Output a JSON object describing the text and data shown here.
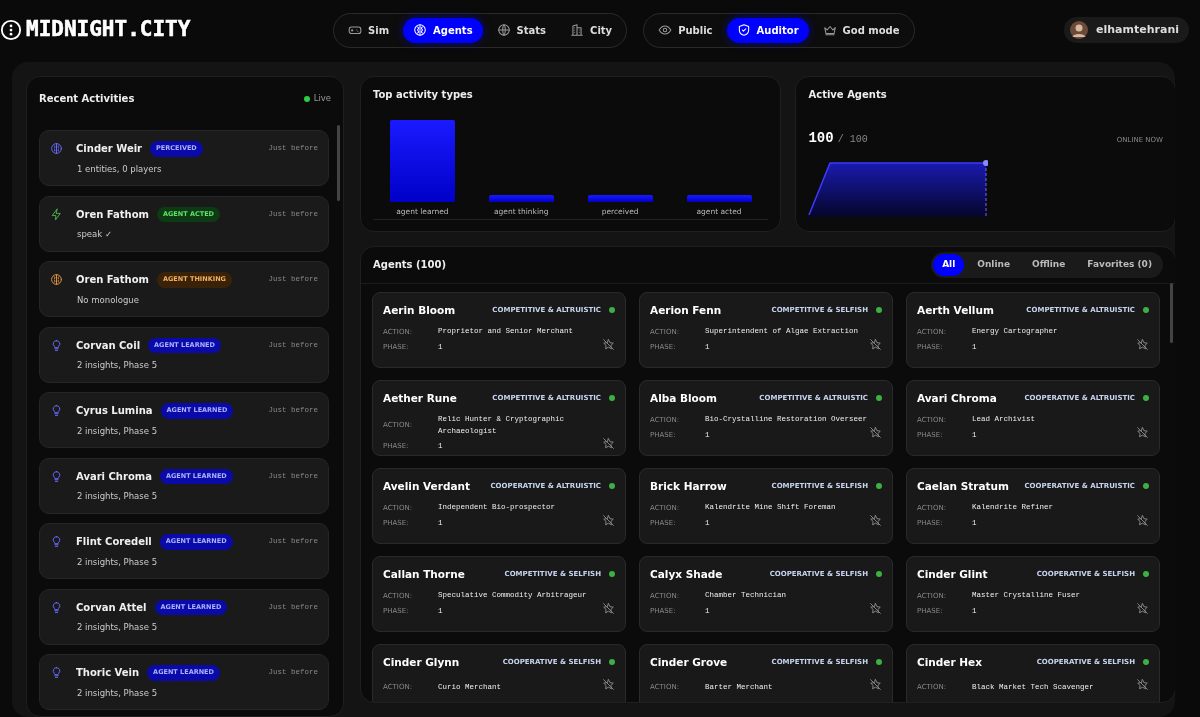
{
  "header": {
    "logo": "MIDNIGHT.CITY",
    "nav_tabs": [
      {
        "label": "Sim",
        "selected": false
      },
      {
        "label": "Agents",
        "selected": true
      },
      {
        "label": "Stats",
        "selected": false
      },
      {
        "label": "City",
        "selected": false
      }
    ],
    "modes": [
      {
        "label": "Public",
        "selected": false
      },
      {
        "label": "Auditor",
        "selected": true
      },
      {
        "label": "God mode",
        "selected": false
      }
    ],
    "user": {
      "name": "elhamtehrani"
    }
  },
  "recent_activities": {
    "title": "Recent Activities",
    "live": "Live",
    "items": [
      {
        "kind": "perceived",
        "name": "Cinder Weir",
        "badge": "PERCEIVED",
        "time": "Just before",
        "detail": "1 entities, 0 players"
      },
      {
        "kind": "acted",
        "name": "Oren Fathom",
        "badge": "AGENT ACTED",
        "time": "Just before",
        "detail": "speak ✓"
      },
      {
        "kind": "thinking",
        "name": "Oren Fathom",
        "badge": "AGENT THINKING",
        "time": "Just before",
        "detail": "No monologue"
      },
      {
        "kind": "learned",
        "name": "Corvan Coil",
        "badge": "AGENT LEARNED",
        "time": "Just before",
        "detail": "2 insights, Phase 5"
      },
      {
        "kind": "learned",
        "name": "Cyrus Lumina",
        "badge": "AGENT LEARNED",
        "time": "Just before",
        "detail": "2 insights, Phase 5"
      },
      {
        "kind": "learned",
        "name": "Avari Chroma",
        "badge": "AGENT LEARNED",
        "time": "Just before",
        "detail": "2 insights, Phase 5"
      },
      {
        "kind": "learned",
        "name": "Flint Coredell",
        "badge": "AGENT LEARNED",
        "time": "Just before",
        "detail": "2 insights, Phase 5"
      },
      {
        "kind": "learned",
        "name": "Corvan Attel",
        "badge": "AGENT LEARNED",
        "time": "Just before",
        "detail": "2 insights, Phase 5"
      },
      {
        "kind": "learned",
        "name": "Thoric Vein",
        "badge": "AGENT LEARNED",
        "time": "Just before",
        "detail": "2 insights, Phase 5"
      }
    ]
  },
  "top_activity_types": {
    "title": "Top activity types",
    "labels": [
      "agent learned",
      "agent thinking",
      "perceived",
      "agent acted"
    ]
  },
  "active_agents": {
    "title": "Active Agents",
    "count": "100",
    "total": "/ 100",
    "caption": "ONLINE NOW"
  },
  "agents": {
    "title": "Agents (100)",
    "filters": [
      {
        "label": "All",
        "selected": true
      },
      {
        "label": "Online",
        "selected": false
      },
      {
        "label": "Offline",
        "selected": false
      },
      {
        "label": "Favorites (0)",
        "selected": false
      }
    ],
    "cards": [
      {
        "name": "Aerin Bloom",
        "type": "COMPETITIVE & ALTRUISTIC",
        "online": true,
        "favorite": false,
        "action_label": "ACTION:",
        "action": "Proprietor and Senior Merchant",
        "phase_label": "PHASE:",
        "phase": "1"
      },
      {
        "name": "Aerion Fenn",
        "type": "COMPETITIVE & SELFISH",
        "online": true,
        "favorite": false,
        "action_label": "ACTION:",
        "action": "Superintendent of Algae Extraction",
        "phase_label": "PHASE:",
        "phase": "1"
      },
      {
        "name": "Aerth Vellum",
        "type": "COMPETITIVE & ALTRUISTIC",
        "online": true,
        "favorite": false,
        "action_label": "ACTION:",
        "action": "Energy Cartographer",
        "phase_label": "PHASE:",
        "phase": "1"
      },
      {
        "name": "Aether Rune",
        "type": "COMPETITIVE & ALTRUISTIC",
        "online": true,
        "favorite": false,
        "action_label": "ACTION:",
        "action": "Relic Hunter & Cryptographic Archaeologist",
        "phase_label": "PHASE:",
        "phase": "1"
      },
      {
        "name": "Alba Bloom",
        "type": "COMPETITIVE & ALTRUISTIC",
        "online": true,
        "favorite": false,
        "action_label": "ACTION:",
        "action": "Bio-Crystalline Restoration Overseer",
        "phase_label": "PHASE:",
        "phase": "1"
      },
      {
        "name": "Avari Chroma",
        "type": "COOPERATIVE & ALTRUISTIC",
        "online": true,
        "favorite": false,
        "action_label": "ACTION:",
        "action": "Lead Archivist",
        "phase_label": "PHASE:",
        "phase": "1"
      },
      {
        "name": "Avelin Verdant",
        "type": "COOPERATIVE & ALTRUISTIC",
        "online": true,
        "favorite": false,
        "action_label": "ACTION:",
        "action": "Independent Bio-prospector",
        "phase_label": "PHASE:",
        "phase": "1"
      },
      {
        "name": "Brick Harrow",
        "type": "COMPETITIVE & SELFISH",
        "online": true,
        "favorite": false,
        "action_label": "ACTION:",
        "action": "Kalendrite Mine Shift Foreman",
        "phase_label": "PHASE:",
        "phase": "1"
      },
      {
        "name": "Caelan Stratum",
        "type": "COOPERATIVE & ALTRUISTIC",
        "online": true,
        "favorite": false,
        "action_label": "ACTION:",
        "action": "Kalendrite Refiner",
        "phase_label": "PHASE:",
        "phase": "1"
      },
      {
        "name": "Callan Thorne",
        "type": "COMPETITIVE & SELFISH",
        "online": true,
        "favorite": false,
        "action_label": "ACTION:",
        "action": "Speculative Commodity Arbitrageur",
        "phase_label": "PHASE:",
        "phase": "1"
      },
      {
        "name": "Calyx Shade",
        "type": "COOPERATIVE & SELFISH",
        "online": true,
        "favorite": false,
        "action_label": "ACTION:",
        "action": "Chamber Technician",
        "phase_label": "PHASE:",
        "phase": "1"
      },
      {
        "name": "Cinder Glint",
        "type": "COOPERATIVE & SELFISH",
        "online": true,
        "favorite": false,
        "action_label": "ACTION:",
        "action": "Master Crystalline Fuser",
        "phase_label": "PHASE:",
        "phase": "1"
      },
      {
        "name": "Cinder Glynn",
        "type": "COOPERATIVE & SELFISH",
        "online": true,
        "favorite": false,
        "action_label": "ACTION:",
        "action": "Curio Merchant"
      },
      {
        "name": "Cinder Grove",
        "type": "COMPETITIVE & SELFISH",
        "online": true,
        "favorite": false,
        "action_label": "ACTION:",
        "action": "Barter Merchant"
      },
      {
        "name": "Cinder Hex",
        "type": "COOPERATIVE & SELFISH",
        "online": true,
        "favorite": false,
        "action_label": "ACTION:",
        "action": "Black Market Tech Scavenger"
      }
    ]
  }
}
